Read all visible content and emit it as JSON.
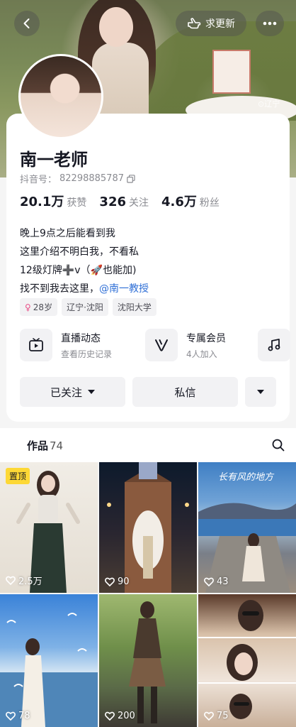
{
  "header": {
    "update_label": "求更新",
    "cover_watermark": "⊙辽宁"
  },
  "profile": {
    "name": "南一老师",
    "douyin_id_label": "抖音号：",
    "douyin_id": "82298885787",
    "stats": [
      {
        "num": "20.1万",
        "label": "获赞"
      },
      {
        "num": "326",
        "label": "关注"
      },
      {
        "num": "4.6万",
        "label": "粉丝"
      }
    ],
    "bio": {
      "line1": "晚上9点之后能看到我",
      "line2": "这里介绍不明白我，不看私",
      "line3": "12级灯牌➕v（🚀也能加)",
      "line4_prefix": "找不到我去这里，",
      "line4_mention": "@南一教授"
    },
    "tags": {
      "age": "28岁",
      "location": "辽宁·沈阳",
      "school": "沈阳大学"
    }
  },
  "features": {
    "live": {
      "title": "直播动态",
      "sub": "查看历史记录"
    },
    "member": {
      "title": "专属会员",
      "sub": "4人加入"
    }
  },
  "actions": {
    "followed": "已关注",
    "message": "私信"
  },
  "tabs": {
    "works_label": "作品",
    "works_count": "74"
  },
  "videos": [
    {
      "likes": "2.5万",
      "pinned": "置顶",
      "caption": ""
    },
    {
      "likes": "90",
      "pinned": "",
      "caption": ""
    },
    {
      "likes": "43",
      "pinned": "",
      "caption": "长有风的地方"
    },
    {
      "likes": "78",
      "pinned": "",
      "caption": ""
    },
    {
      "likes": "200",
      "pinned": "",
      "caption": ""
    },
    {
      "likes": "75",
      "pinned": "",
      "caption": ""
    }
  ]
}
